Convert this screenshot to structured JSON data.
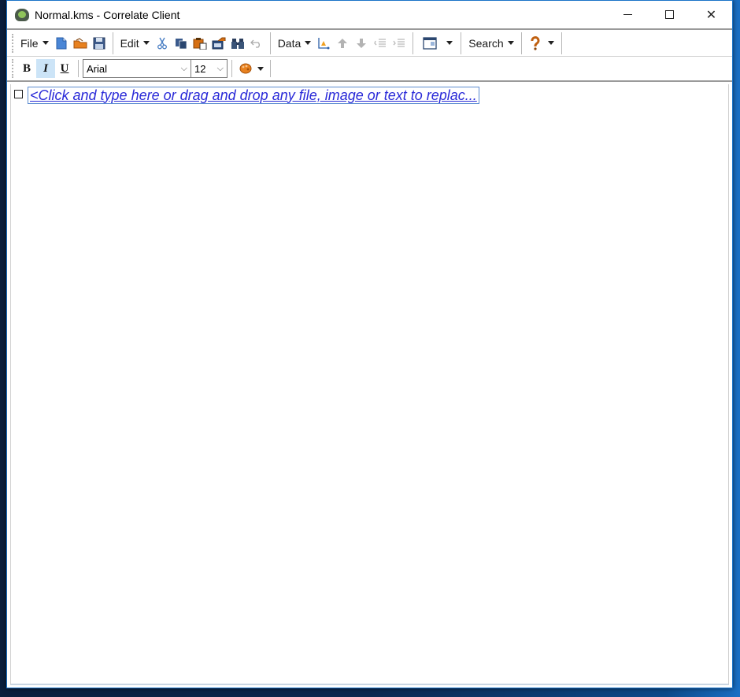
{
  "window": {
    "title": "Normal.kms - Correlate Client",
    "controls": {
      "minimize": "minimize",
      "maximize": "maximize",
      "close": "✕"
    }
  },
  "toolbar": {
    "file_label": "File",
    "edit_label": "Edit",
    "data_label": "Data",
    "search_label": "Search",
    "icons": {
      "new": "new-document-icon",
      "open": "open-folder-icon",
      "save": "save-icon",
      "cut": "cut-icon",
      "copy": "copy-icon",
      "paste": "paste-icon",
      "paste_special": "paste-special-icon",
      "find": "binoculars-icon",
      "undo": "undo-icon",
      "chart": "chart-icon",
      "move_up": "arrow-up-icon",
      "move_down": "arrow-down-icon",
      "outdent": "outdent-icon",
      "indent": "indent-icon",
      "layout": "layout-icon",
      "help": "help-icon"
    }
  },
  "format_toolbar": {
    "bold": "B",
    "italic": "I",
    "underline": "U",
    "italic_active": true,
    "font_name": "Arial",
    "font_size": "12",
    "chevron": "⌵",
    "color_icon": "color-palette-icon"
  },
  "content": {
    "placeholder": "<Click and type here or drag and drop any file, image or text to replac..."
  }
}
